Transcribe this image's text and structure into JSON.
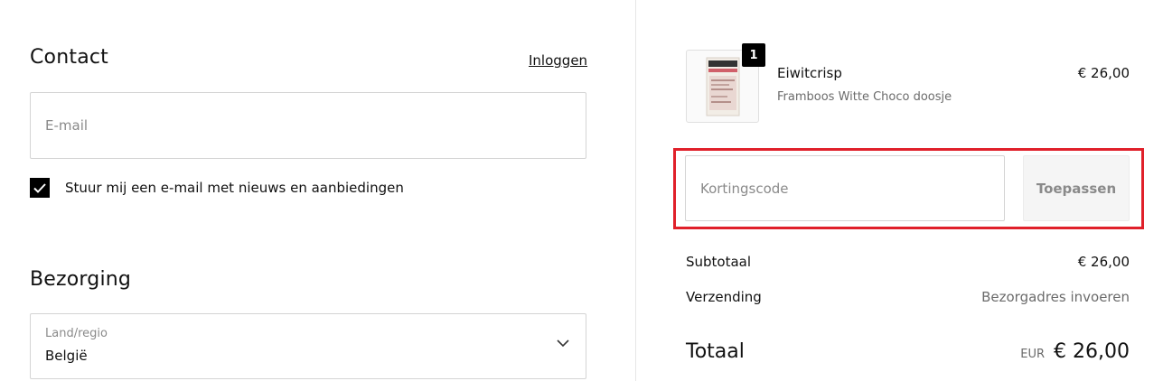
{
  "contact": {
    "title": "Contact",
    "login_link": "Inloggen",
    "email_placeholder": "E-mail",
    "email_value": "",
    "newsletter_label": "Stuur mij een e-mail met nieuws en aanbiedingen",
    "newsletter_checked": true
  },
  "delivery": {
    "title": "Bezorging",
    "country_label": "Land/regio",
    "country_value": "België"
  },
  "order": {
    "item": {
      "quantity": "1",
      "name": "Eiwitcrisp",
      "variant": "Framboos Witte Choco doosje",
      "price": "€ 26,00"
    },
    "discount": {
      "placeholder": "Kortingscode",
      "value": "",
      "apply_label": "Toepassen"
    },
    "subtotal_label": "Subtotaal",
    "subtotal_value": "€ 26,00",
    "shipping_label": "Verzending",
    "shipping_value": "Bezorgadres invoeren",
    "total_label": "Totaal",
    "total_currency": "EUR",
    "total_value": "€ 26,00"
  },
  "colors": {
    "highlight": "#e0202a",
    "checkbox": "#000000",
    "badge": "#000000"
  },
  "icons": {
    "checkbox": "check-icon",
    "select": "chevron-down-icon"
  }
}
